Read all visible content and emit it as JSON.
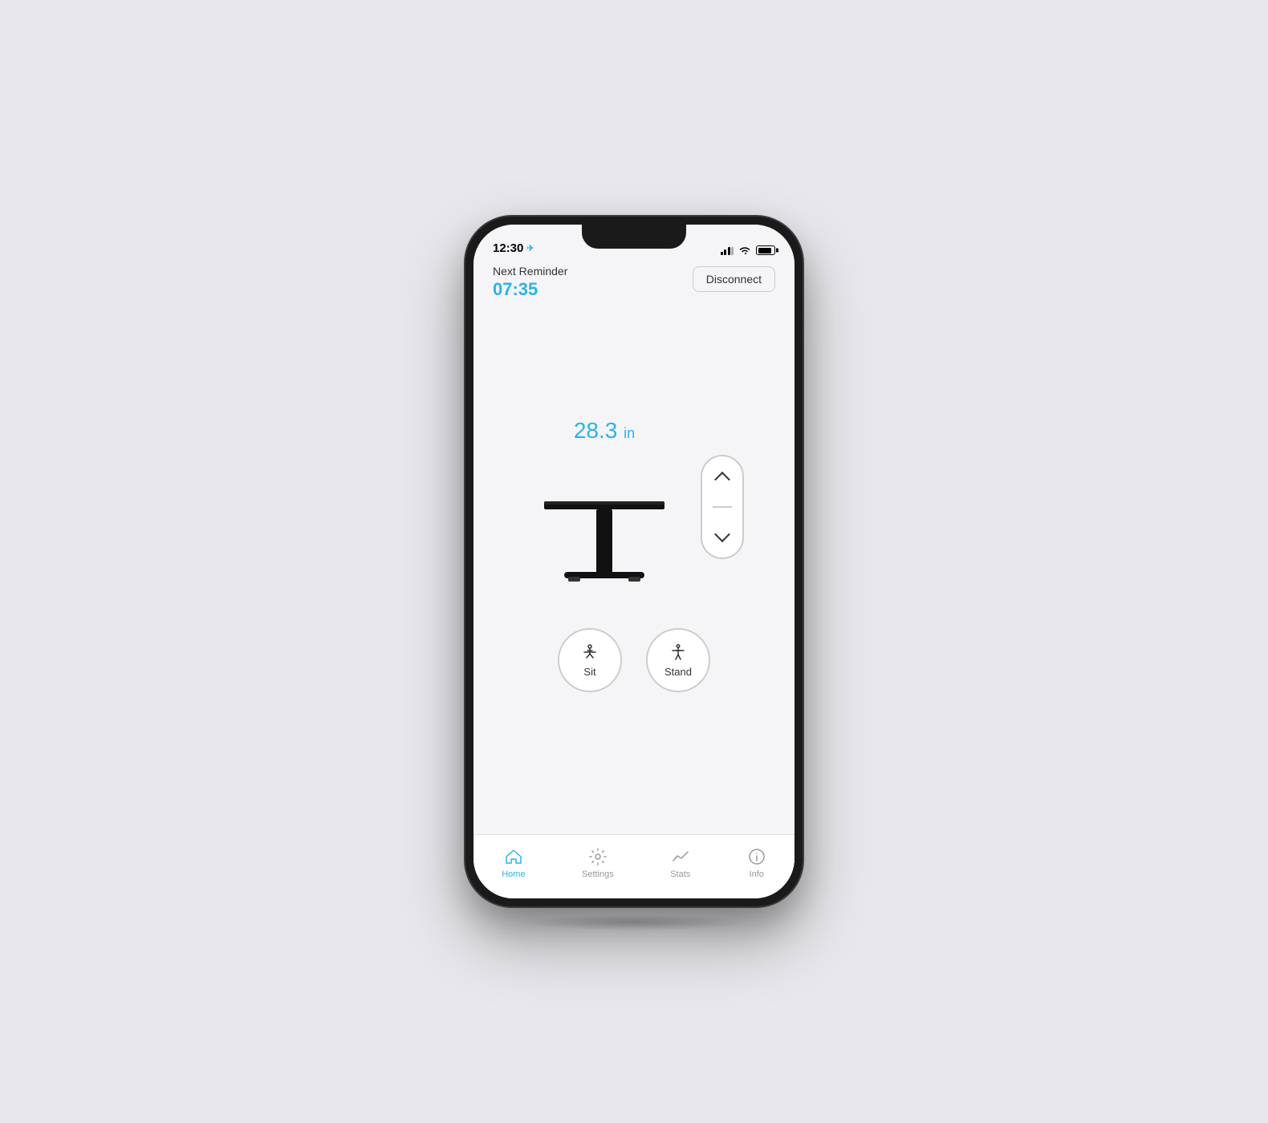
{
  "status_bar": {
    "time": "12:30",
    "location_indicator": "◁"
  },
  "header": {
    "reminder_label": "Next Reminder",
    "reminder_time": "07:35",
    "disconnect_button": "Disconnect"
  },
  "desk": {
    "height_value": "28.3",
    "height_unit": "in"
  },
  "presets": {
    "sit_label": "Sit",
    "stand_label": "Stand"
  },
  "tab_bar": {
    "tabs": [
      {
        "id": "home",
        "label": "Home",
        "active": true
      },
      {
        "id": "settings",
        "label": "Settings",
        "active": false
      },
      {
        "id": "stats",
        "label": "Stats",
        "active": false
      },
      {
        "id": "info",
        "label": "Info",
        "active": false
      }
    ]
  }
}
